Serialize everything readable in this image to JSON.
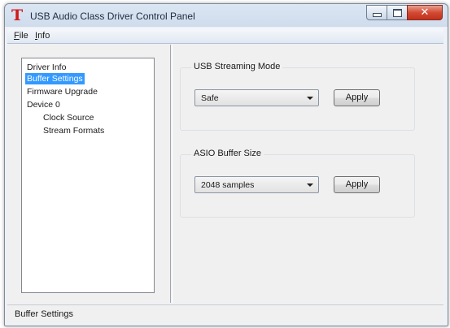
{
  "window": {
    "title": "USB Audio Class Driver Control Panel",
    "app_icon_glyph": "T",
    "icon_color": "#d21a1a",
    "minimize_glyph": "minimize-icon",
    "maximize_glyph": "maximize-icon",
    "close_glyph": "✕"
  },
  "menu": {
    "file": {
      "accelerator": "F",
      "rest": "ile"
    },
    "info": {
      "accelerator": "I",
      "rest": "nfo"
    }
  },
  "tree": {
    "items": [
      {
        "label": "Driver Info",
        "selected": false
      },
      {
        "label": "Buffer Settings",
        "selected": true
      },
      {
        "label": "Firmware Upgrade",
        "selected": false
      },
      {
        "label": "Device 0",
        "selected": false
      },
      {
        "label": "Clock Source",
        "selected": false
      },
      {
        "label": "Stream Formats",
        "selected": false
      }
    ],
    "selection_color": "#3399ff"
  },
  "streaming": {
    "group_title": "USB Streaming Mode",
    "selected": "Safe",
    "apply_label": "Apply"
  },
  "asio": {
    "group_title": "ASIO Buffer Size",
    "selected": "2048 samples",
    "apply_label": "Apply"
  },
  "status": {
    "text": "Buffer Settings"
  }
}
